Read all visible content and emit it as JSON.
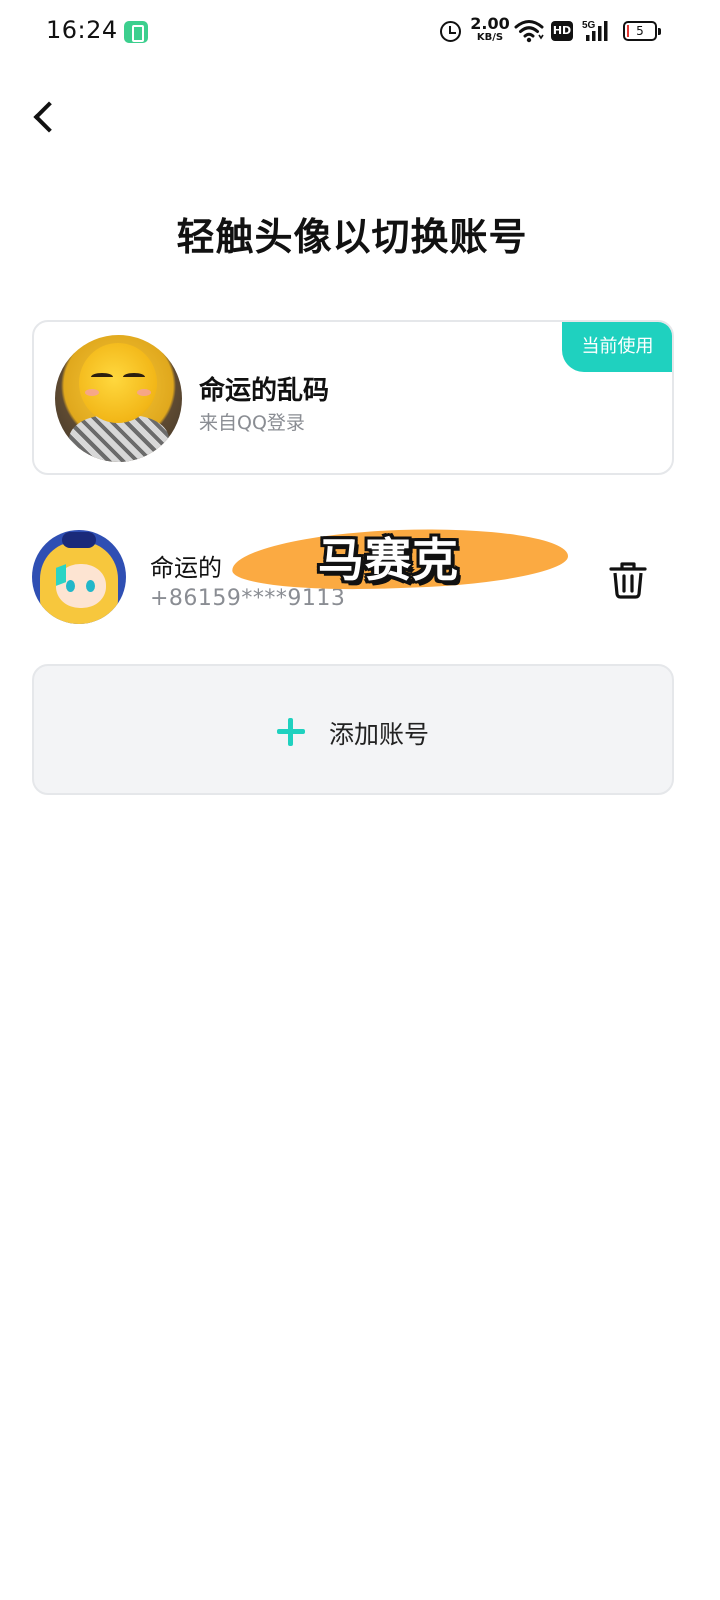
{
  "status_bar": {
    "time": "16:24",
    "net_speed_value": "2.00",
    "net_speed_unit": "KB/S",
    "hd_label": "HD",
    "network_type": "5G",
    "battery_level": "5",
    "icons": [
      "battery-saver-icon",
      "alarm-icon",
      "wifi-icon",
      "hd-icon",
      "signal-icon",
      "battery-icon"
    ]
  },
  "header": {
    "back_icon": "chevron-left-icon",
    "title": "轻触头像以切换账号"
  },
  "current_account": {
    "badge": "当前使用",
    "name": "命运的乱码",
    "source": "来自QQ登录"
  },
  "other_accounts": [
    {
      "name": "命运的",
      "phone": "+86159****9113",
      "censor_overlay": "马赛克",
      "delete_icon": "trash-icon"
    }
  ],
  "add_account": {
    "icon": "plus-icon",
    "label": "添加账号"
  },
  "colors": {
    "accent": "#1fd1bf",
    "card_border": "#e5e7ea",
    "add_bg": "#f3f4f6",
    "secondary_text": "#8a8d93",
    "censor_orange": "#fbaa42"
  }
}
